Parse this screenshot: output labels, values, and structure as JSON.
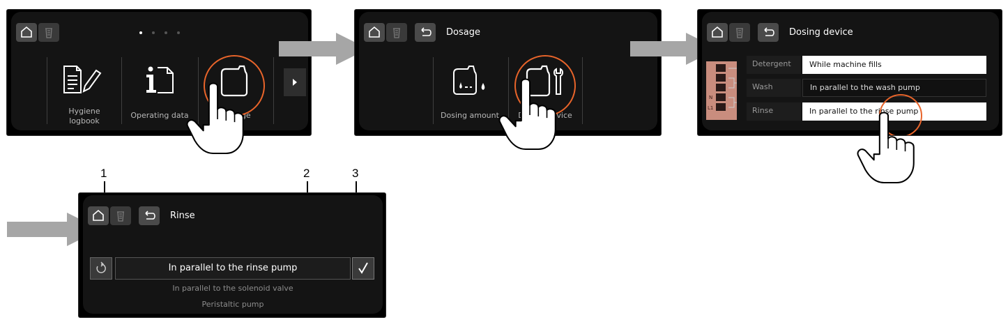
{
  "screen1": {
    "label_hygiene": "Hygiene\nlogbook",
    "label_operating": "Operating data",
    "label_dosage": "Dosage"
  },
  "screen2": {
    "title": "Dosage",
    "label_amount": "Dosing amount",
    "label_device": "Dosing device"
  },
  "screen3": {
    "title": "Dosing device",
    "rows": [
      {
        "label": "Detergent",
        "value": "While machine fills"
      },
      {
        "label": "Wash",
        "value": "In parallel to the wash pump"
      },
      {
        "label": "Rinse",
        "value": "In parallel to the rinse pump"
      }
    ],
    "terminal_labels": [
      "N",
      "L1"
    ]
  },
  "screen4": {
    "title": "Rinse",
    "selected_value": "In parallel to the rinse pump",
    "options": [
      "In parallel to the solenoid valve",
      "Peristaltic pump"
    ]
  },
  "callouts": [
    "1",
    "2",
    "3"
  ],
  "colors": {
    "highlight": "#e8642a",
    "arrow": "#a6a6a6",
    "button": "#4a4a4a"
  }
}
